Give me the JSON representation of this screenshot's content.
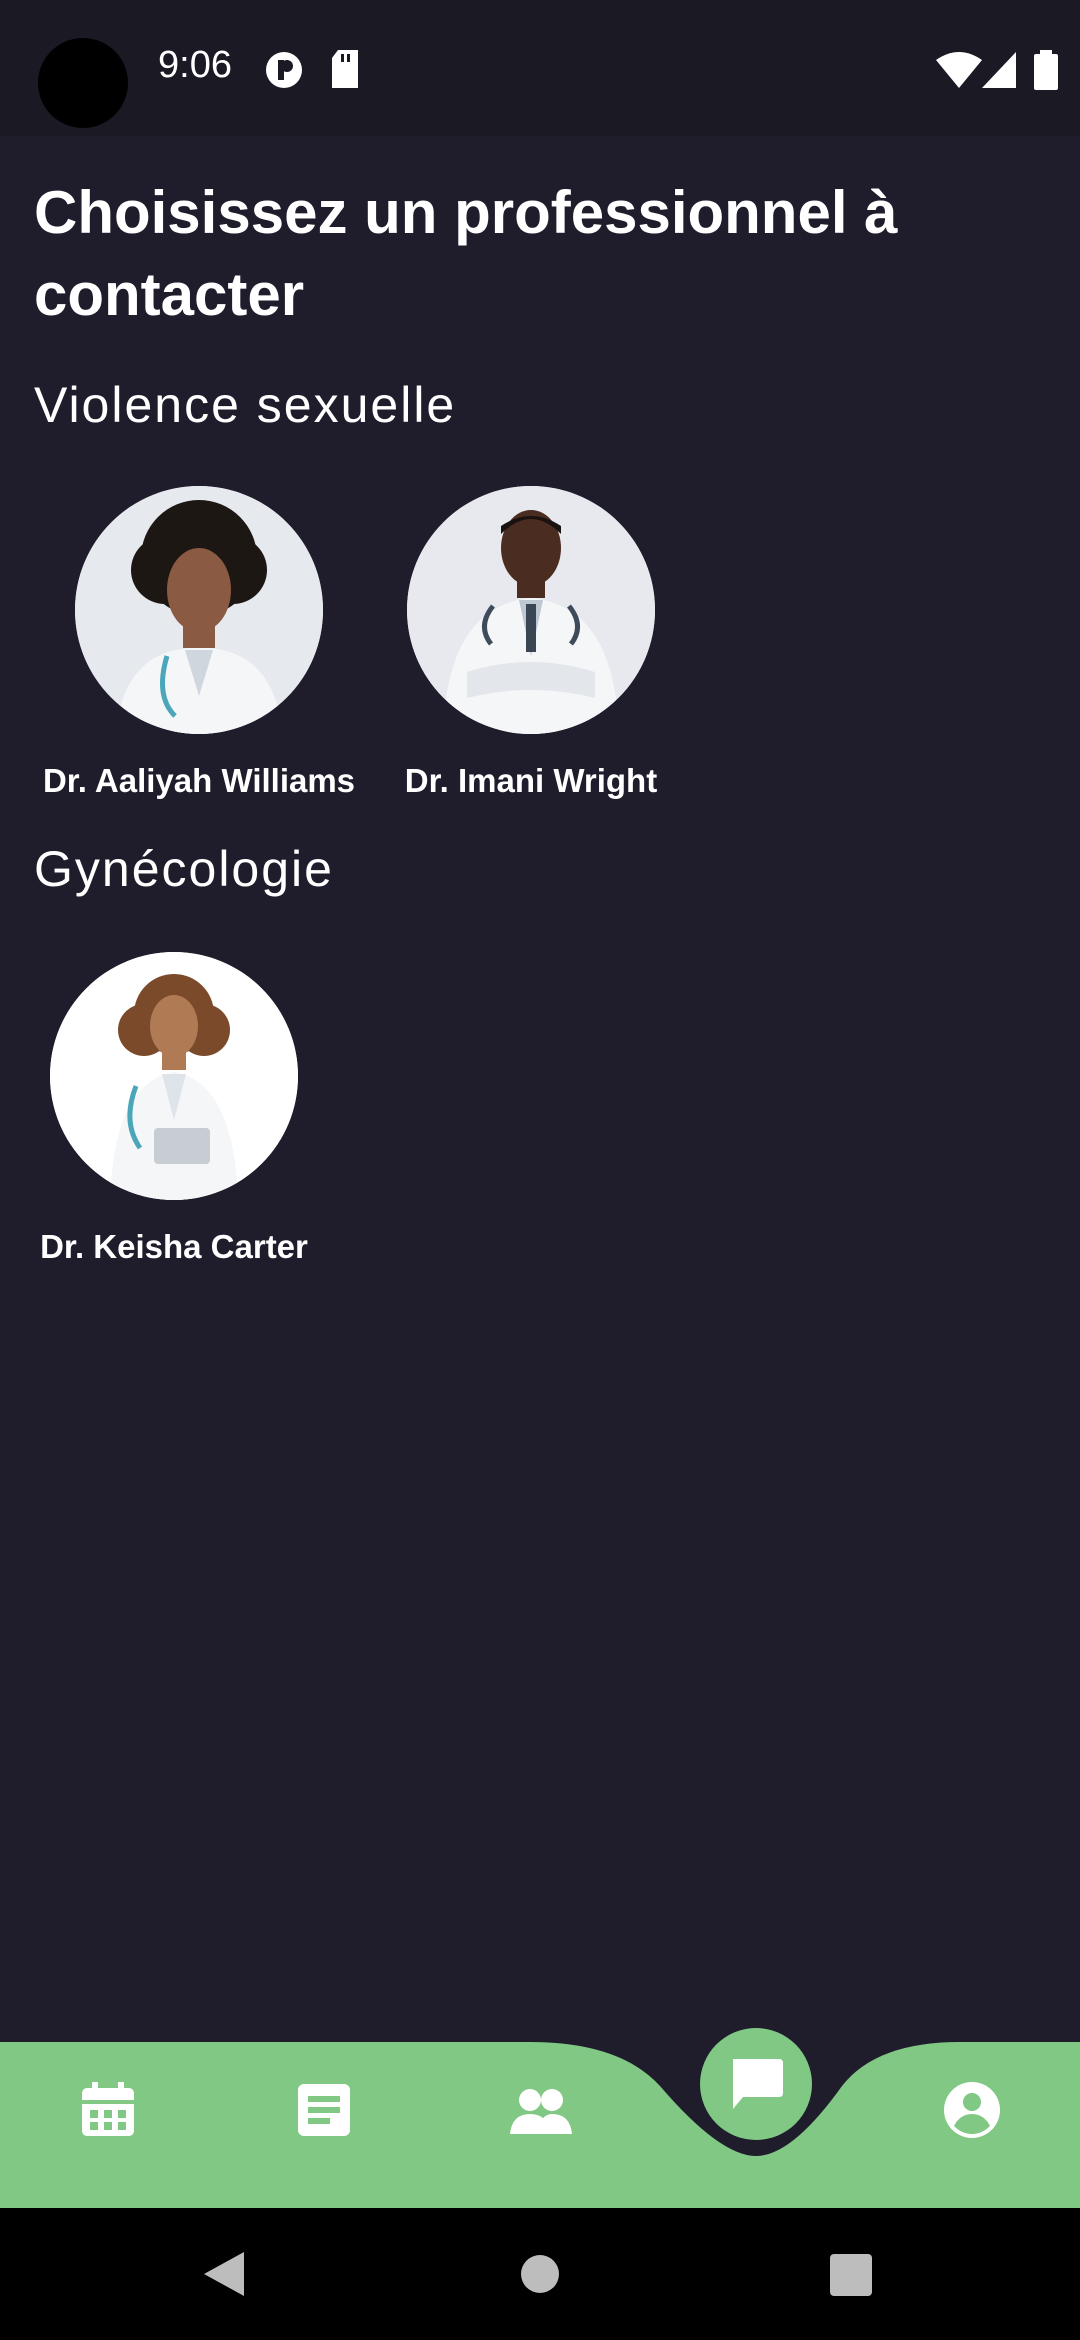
{
  "status_bar": {
    "time": "9:06",
    "icons": [
      "circle-p-icon",
      "sd-card-icon",
      "wifi-icon",
      "signal-icon",
      "battery-icon"
    ]
  },
  "page": {
    "title": "Choisissez un professionnel à contacter"
  },
  "sections": [
    {
      "title": "Violence sexuelle",
      "doctors": [
        {
          "name": "Dr. Aaliyah Williams"
        },
        {
          "name": "Dr. Imani Wright"
        }
      ]
    },
    {
      "title": "Gynécologie",
      "doctors": [
        {
          "name": "Dr. Keisha Carter"
        }
      ]
    }
  ],
  "bottom_nav": {
    "items": [
      "calendar-icon",
      "notes-icon",
      "group-icon",
      "chat-icon",
      "profile-icon"
    ],
    "active": "chat-icon",
    "color": "#80c883",
    "background": "#1f1d2c"
  },
  "system_nav": {
    "buttons": [
      "back-button",
      "home-button",
      "recents-button"
    ]
  }
}
